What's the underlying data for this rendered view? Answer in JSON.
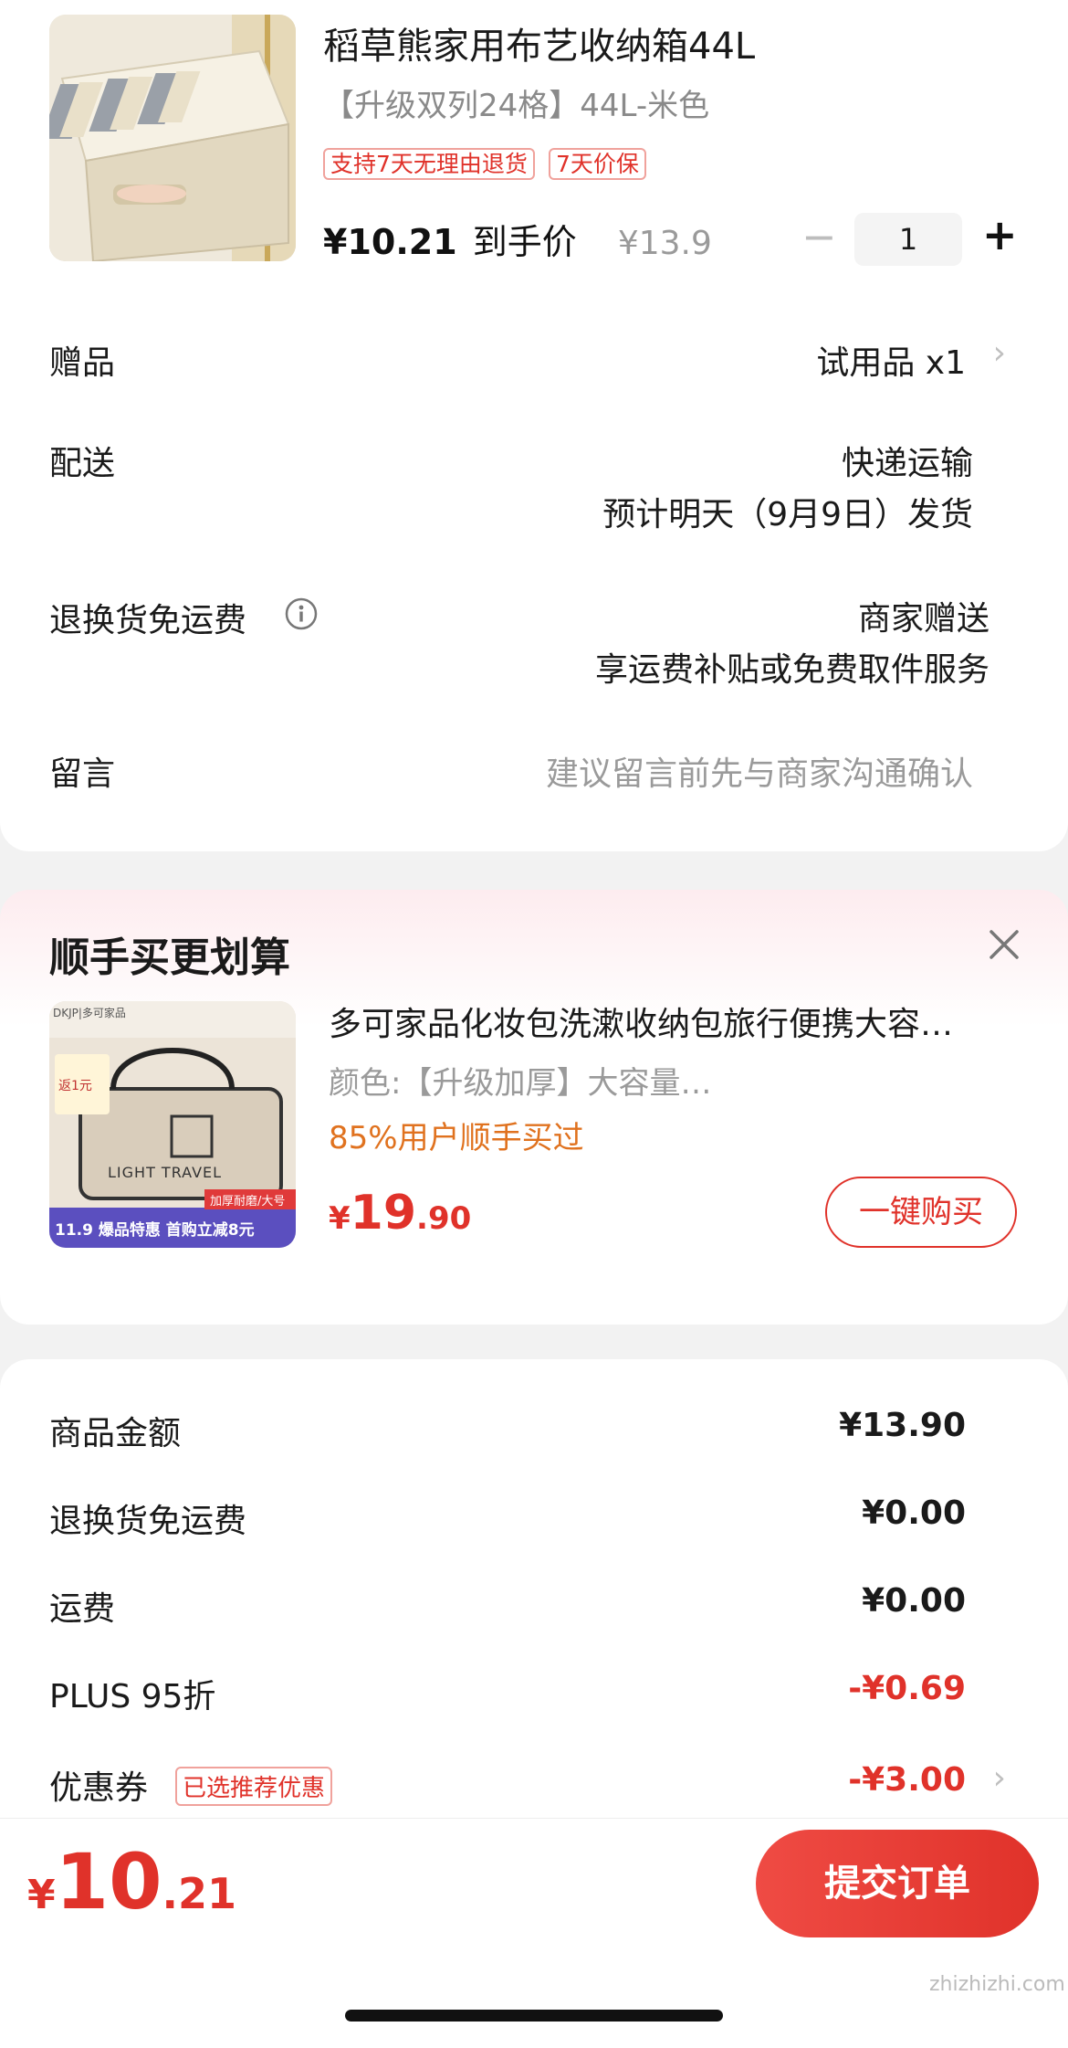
{
  "product": {
    "title": "稻草熊家用布艺收纳箱44L",
    "spec": "【升级双列24格】44L-米色",
    "tags": [
      "支持7天无理由退货",
      "7天价保"
    ],
    "price": "¥10.21",
    "price_suffix": "到手价",
    "original_price": "¥13.9",
    "quantity": "1",
    "minus": "−",
    "plus": "+"
  },
  "rows": {
    "gift": {
      "label": "赠品",
      "value": "试用品 x1"
    },
    "delivery": {
      "label": "配送",
      "value1": "快递运输",
      "value2": "预计明天（9月9日）发货"
    },
    "return": {
      "label": "退换货免运费",
      "value1": "商家赠送",
      "value2": "享运费补贴或免费取件服务"
    },
    "message": {
      "label": "留言",
      "placeholder": "建议留言前先与商家沟通确认"
    }
  },
  "recommend": {
    "title": "顺手买更划算",
    "name": "多可家品化妆包洗漱收纳包旅行便携大容…",
    "spec": "颜色:【升级加厚】大容量…",
    "rate": "85%用户顺手买过",
    "price_symbol": "¥",
    "price_int": "19",
    "price_dec": ".90",
    "buy_label": "一键购买",
    "thumb_texts": {
      "brand": "DKJP|多可家品",
      "badge": "返1元",
      "logo_text": "LIGHT TRAVEL",
      "ribbon": "加厚耐磨/大号",
      "banner": "11.9 爆品特惠 首购立减8元"
    }
  },
  "summary": [
    {
      "label": "商品金额",
      "value": "¥13.90",
      "highlight": false
    },
    {
      "label": "退换货免运费",
      "value": "¥0.00",
      "highlight": false
    },
    {
      "label": "运费",
      "value": "¥0.00",
      "highlight": false
    },
    {
      "label": "PLUS 95折",
      "value": "-¥0.69",
      "highlight": true
    },
    {
      "label": "优惠券",
      "value": "-¥3.00",
      "highlight": true,
      "tag": "已选推荐优惠"
    }
  ],
  "footer": {
    "total_symbol": "¥",
    "total_int": "10",
    "total_dec": ".21",
    "submit_label": "提交订单"
  },
  "watermark": "zhizhizhi.com",
  "colors": {
    "accent": "#e0322a",
    "orange": "#e0721f",
    "muted": "#9a9a9a"
  }
}
